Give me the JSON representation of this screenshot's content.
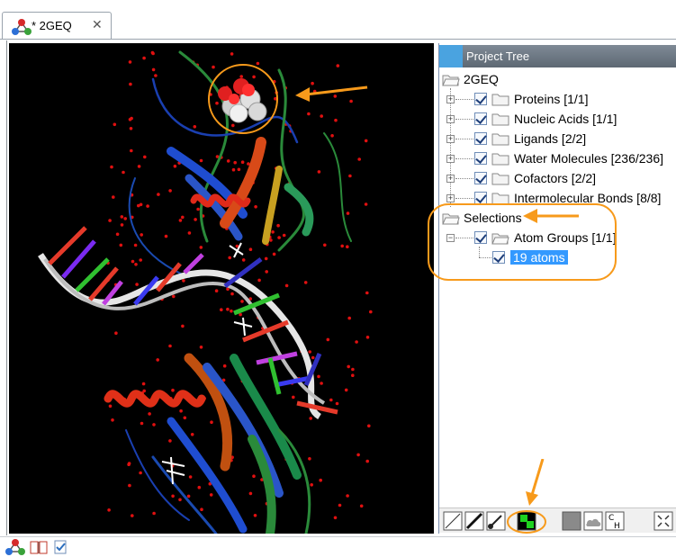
{
  "tab": {
    "title": "* 2GEQ",
    "close": "✕"
  },
  "panel": {
    "title": "Project Tree"
  },
  "tree": {
    "root": "2GEQ",
    "items": [
      {
        "label": "Proteins [1/1]"
      },
      {
        "label": "Nucleic Acids [1/1]"
      },
      {
        "label": "Ligands [2/2]"
      },
      {
        "label": "Water Molecules [236/236]"
      },
      {
        "label": "Cofactors [2/2]"
      },
      {
        "label": "Intermolecular Bonds [8/8]"
      }
    ],
    "selections": {
      "label": "Selections",
      "group": "Atom Groups [1/1]",
      "selected": "19 atoms"
    }
  },
  "toolbar_icons": [
    "line-style-icon",
    "bold-line-icon",
    "ball-stick-icon",
    "selection-color-icon",
    "surface-icon",
    "cloud-icon",
    "hydrogen-icon",
    "fit-icon"
  ],
  "statusbar_icons": [
    "structure-icon",
    "book-icon",
    "check-edit-icon"
  ],
  "colors": {
    "accent": "#f79a1b",
    "selection": "#3399ff",
    "background": "#000000"
  }
}
